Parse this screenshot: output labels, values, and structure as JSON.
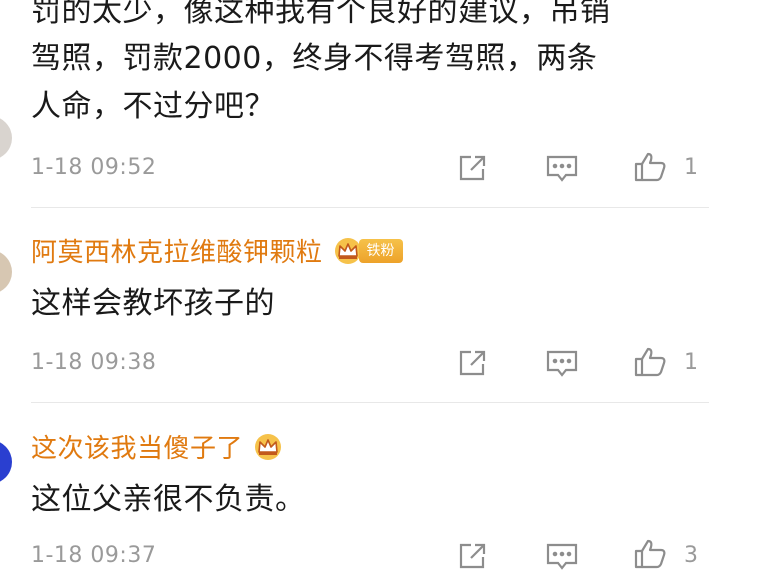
{
  "comments": [
    {
      "lines": [
        "罚的太少，像这种我有个良好的建议，吊销",
        "驾照，罚款2000，终身不得考驾照，两条",
        "人命，不过分吧？"
      ],
      "time": "1-18 09:52",
      "likes": "1"
    },
    {
      "username": "阿莫西林克拉维酸钾颗粒",
      "badge": "铁粉",
      "text": "这样会教坏孩子的",
      "time": "1-18 09:38",
      "likes": "1"
    },
    {
      "username": "这次该我当傻子了",
      "text": "这位父亲很不负责。",
      "time": "1-18 09:37",
      "likes": "3"
    }
  ],
  "icons": {
    "share": "share-icon",
    "reply": "comment-icon",
    "like": "thumbs-up-icon",
    "badge": "crown-icon"
  },
  "colors": {
    "username": "#e07a10",
    "meta": "#9a9a9a",
    "badge": "#f0a830"
  }
}
